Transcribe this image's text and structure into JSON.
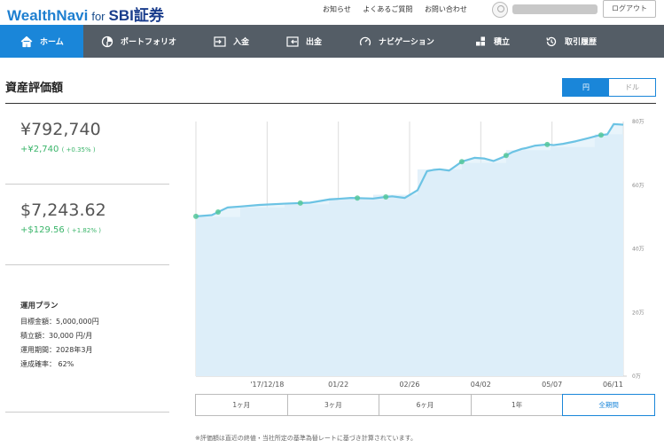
{
  "header": {
    "brand_main": "WealthNavi",
    "brand_for": "for",
    "brand_partner": "SBI証券",
    "links": [
      "お知らせ",
      "よくあるご質問",
      "お問い合わせ"
    ],
    "logout_label": "ログアウト"
  },
  "nav": {
    "items": [
      {
        "label": "ホーム",
        "icon": "home-icon",
        "active": true
      },
      {
        "label": "ポートフォリオ",
        "icon": "pie-chart-icon",
        "active": false
      },
      {
        "label": "入金",
        "icon": "deposit-icon",
        "active": false
      },
      {
        "label": "出金",
        "icon": "withdraw-icon",
        "active": false
      },
      {
        "label": "ナビゲーション",
        "icon": "gauge-icon",
        "active": false
      },
      {
        "label": "積立",
        "icon": "blocks-icon",
        "active": false
      },
      {
        "label": "取引履歴",
        "icon": "history-icon",
        "active": false
      }
    ]
  },
  "page": {
    "title": "資産評価額",
    "currency_yen": "円",
    "currency_usd": "ドル",
    "selected_currency": "円"
  },
  "assets": {
    "jpy_value": "¥792,740",
    "jpy_gain": "+¥2,740",
    "jpy_gain_pct": "( +0.35% )",
    "usd_value": "$7,243.62",
    "usd_gain": "+$129.56",
    "usd_gain_pct": "( +1.82% )"
  },
  "plan": {
    "title": "運用プラン",
    "target": "目標金額：5,000,000円",
    "monthly": "積立額：30,000 円/月",
    "period": "運用期間：2028年3月",
    "probability": "達成確率： 62%"
  },
  "chart_data": {
    "type": "area",
    "x_tick_labels": [
      "'17/12/18",
      "01/22",
      "02/26",
      "04/02",
      "05/07",
      "06/11"
    ],
    "y_tick_labels": [
      "0万",
      "20万",
      "40万",
      "60万",
      "80万"
    ],
    "ylim": [
      0,
      80
    ],
    "series": [
      {
        "x": [
          0,
          5,
          10,
          14,
          20,
          28,
          36,
          42,
          49,
          56,
          60,
          62,
          66,
          70,
          73,
          75,
          77,
          80,
          84,
          88,
          91,
          94,
          97,
          100,
          103,
          104,
          107,
          111,
          113,
          116,
          120,
          124,
          127,
          130,
          132,
          135
        ],
        "values": [
          50.2,
          50.6,
          53.0,
          53.3,
          53.8,
          54.2,
          54.5,
          55.5,
          56.0,
          55.8,
          56.3,
          56.5,
          56.0,
          58.4,
          64.4,
          64.8,
          65.0,
          64.6,
          67.4,
          68.6,
          68.4,
          67.6,
          68.8,
          70.4,
          71.4,
          71.6,
          72.4,
          72.8,
          72.6,
          73.0,
          73.8,
          74.8,
          75.6,
          76.0,
          79.2,
          79.0
        ]
      },
      {
        "x": [
          0,
          14,
          28,
          42,
          56,
          70,
          84,
          98,
          112,
          126,
          135
        ],
        "values": [
          50,
          53,
          54,
          56,
          57,
          65,
          67,
          71,
          72,
          76,
          79
        ]
      }
    ],
    "markers_x": [
      0,
      7,
      33,
      51,
      60,
      84,
      98,
      111,
      128
    ],
    "grid": true
  },
  "periods": {
    "items": [
      "1ヶ月",
      "3ヶ月",
      "6ヶ月",
      "1年",
      "全期間"
    ],
    "active": "全期間"
  },
  "footnote": "※評価額は直近の終値・当社所定の基準為替レートに基づき計算されています。"
}
